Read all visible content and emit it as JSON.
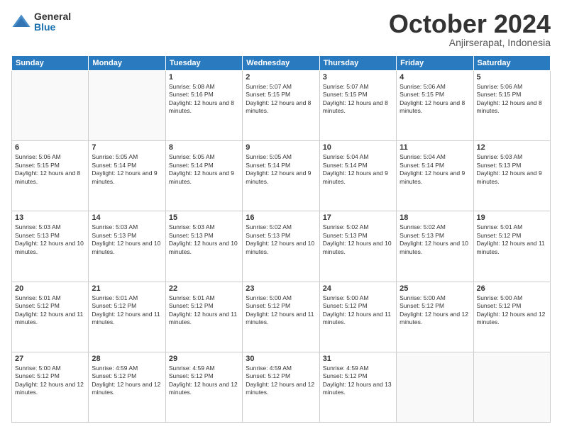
{
  "logo": {
    "general": "General",
    "blue": "Blue"
  },
  "header": {
    "month": "October 2024",
    "location": "Anjirserapat, Indonesia"
  },
  "days_of_week": [
    "Sunday",
    "Monday",
    "Tuesday",
    "Wednesday",
    "Thursday",
    "Friday",
    "Saturday"
  ],
  "weeks": [
    [
      {
        "day": "",
        "info": ""
      },
      {
        "day": "",
        "info": ""
      },
      {
        "day": "1",
        "info": "Sunrise: 5:08 AM\nSunset: 5:16 PM\nDaylight: 12 hours and 8 minutes."
      },
      {
        "day": "2",
        "info": "Sunrise: 5:07 AM\nSunset: 5:15 PM\nDaylight: 12 hours and 8 minutes."
      },
      {
        "day": "3",
        "info": "Sunrise: 5:07 AM\nSunset: 5:15 PM\nDaylight: 12 hours and 8 minutes."
      },
      {
        "day": "4",
        "info": "Sunrise: 5:06 AM\nSunset: 5:15 PM\nDaylight: 12 hours and 8 minutes."
      },
      {
        "day": "5",
        "info": "Sunrise: 5:06 AM\nSunset: 5:15 PM\nDaylight: 12 hours and 8 minutes."
      }
    ],
    [
      {
        "day": "6",
        "info": "Sunrise: 5:06 AM\nSunset: 5:15 PM\nDaylight: 12 hours and 8 minutes."
      },
      {
        "day": "7",
        "info": "Sunrise: 5:05 AM\nSunset: 5:14 PM\nDaylight: 12 hours and 9 minutes."
      },
      {
        "day": "8",
        "info": "Sunrise: 5:05 AM\nSunset: 5:14 PM\nDaylight: 12 hours and 9 minutes."
      },
      {
        "day": "9",
        "info": "Sunrise: 5:05 AM\nSunset: 5:14 PM\nDaylight: 12 hours and 9 minutes."
      },
      {
        "day": "10",
        "info": "Sunrise: 5:04 AM\nSunset: 5:14 PM\nDaylight: 12 hours and 9 minutes."
      },
      {
        "day": "11",
        "info": "Sunrise: 5:04 AM\nSunset: 5:14 PM\nDaylight: 12 hours and 9 minutes."
      },
      {
        "day": "12",
        "info": "Sunrise: 5:03 AM\nSunset: 5:13 PM\nDaylight: 12 hours and 9 minutes."
      }
    ],
    [
      {
        "day": "13",
        "info": "Sunrise: 5:03 AM\nSunset: 5:13 PM\nDaylight: 12 hours and 10 minutes."
      },
      {
        "day": "14",
        "info": "Sunrise: 5:03 AM\nSunset: 5:13 PM\nDaylight: 12 hours and 10 minutes."
      },
      {
        "day": "15",
        "info": "Sunrise: 5:03 AM\nSunset: 5:13 PM\nDaylight: 12 hours and 10 minutes."
      },
      {
        "day": "16",
        "info": "Sunrise: 5:02 AM\nSunset: 5:13 PM\nDaylight: 12 hours and 10 minutes."
      },
      {
        "day": "17",
        "info": "Sunrise: 5:02 AM\nSunset: 5:13 PM\nDaylight: 12 hours and 10 minutes."
      },
      {
        "day": "18",
        "info": "Sunrise: 5:02 AM\nSunset: 5:13 PM\nDaylight: 12 hours and 10 minutes."
      },
      {
        "day": "19",
        "info": "Sunrise: 5:01 AM\nSunset: 5:12 PM\nDaylight: 12 hours and 11 minutes."
      }
    ],
    [
      {
        "day": "20",
        "info": "Sunrise: 5:01 AM\nSunset: 5:12 PM\nDaylight: 12 hours and 11 minutes."
      },
      {
        "day": "21",
        "info": "Sunrise: 5:01 AM\nSunset: 5:12 PM\nDaylight: 12 hours and 11 minutes."
      },
      {
        "day": "22",
        "info": "Sunrise: 5:01 AM\nSunset: 5:12 PM\nDaylight: 12 hours and 11 minutes."
      },
      {
        "day": "23",
        "info": "Sunrise: 5:00 AM\nSunset: 5:12 PM\nDaylight: 12 hours and 11 minutes."
      },
      {
        "day": "24",
        "info": "Sunrise: 5:00 AM\nSunset: 5:12 PM\nDaylight: 12 hours and 11 minutes."
      },
      {
        "day": "25",
        "info": "Sunrise: 5:00 AM\nSunset: 5:12 PM\nDaylight: 12 hours and 12 minutes."
      },
      {
        "day": "26",
        "info": "Sunrise: 5:00 AM\nSunset: 5:12 PM\nDaylight: 12 hours and 12 minutes."
      }
    ],
    [
      {
        "day": "27",
        "info": "Sunrise: 5:00 AM\nSunset: 5:12 PM\nDaylight: 12 hours and 12 minutes."
      },
      {
        "day": "28",
        "info": "Sunrise: 4:59 AM\nSunset: 5:12 PM\nDaylight: 12 hours and 12 minutes."
      },
      {
        "day": "29",
        "info": "Sunrise: 4:59 AM\nSunset: 5:12 PM\nDaylight: 12 hours and 12 minutes."
      },
      {
        "day": "30",
        "info": "Sunrise: 4:59 AM\nSunset: 5:12 PM\nDaylight: 12 hours and 12 minutes."
      },
      {
        "day": "31",
        "info": "Sunrise: 4:59 AM\nSunset: 5:12 PM\nDaylight: 12 hours and 13 minutes."
      },
      {
        "day": "",
        "info": ""
      },
      {
        "day": "",
        "info": ""
      }
    ]
  ]
}
